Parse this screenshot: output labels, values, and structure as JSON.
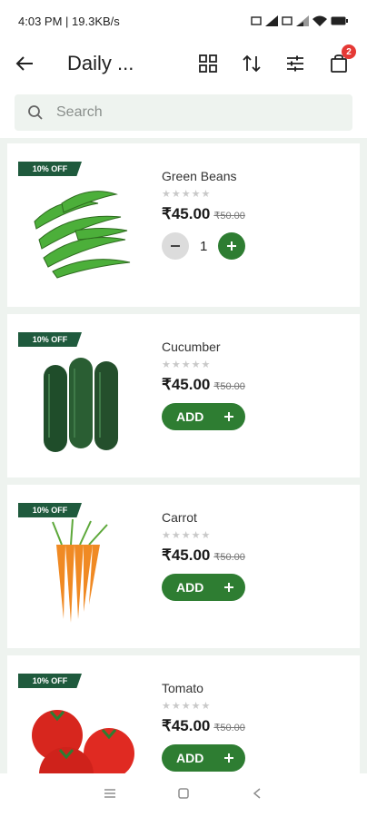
{
  "status_bar": {
    "time_speed": "4:03 PM | 19.3KB/s"
  },
  "app_bar": {
    "title": "Daily ...",
    "cart_count": "2"
  },
  "search": {
    "placeholder": "Search"
  },
  "products": [
    {
      "name": "Green Beans",
      "discount": "10% OFF",
      "price": "₹45.00",
      "mrp": "₹50.00",
      "stars": "★★★★★",
      "in_cart": true,
      "quantity": "1",
      "image": "green-beans"
    },
    {
      "name": "Cucumber",
      "discount": "10% OFF",
      "price": "₹45.00",
      "mrp": "₹50.00",
      "stars": "★★★★★",
      "in_cart": false,
      "add_label": "ADD",
      "image": "cucumber"
    },
    {
      "name": "Carrot",
      "discount": "10% OFF",
      "price": "₹45.00",
      "mrp": "₹50.00",
      "stars": "★★★★★",
      "in_cart": false,
      "add_label": "ADD",
      "image": "carrot"
    },
    {
      "name": "Tomato",
      "discount": "10% OFF",
      "price": "₹45.00",
      "mrp": "₹50.00",
      "stars": "★★★★★",
      "in_cart": false,
      "add_label": "ADD",
      "image": "tomato"
    }
  ],
  "colors": {
    "accent": "#2e7d32",
    "badge": "#1f5a3d",
    "list_bg": "#eef3ef",
    "cart_badge": "#e53935"
  }
}
